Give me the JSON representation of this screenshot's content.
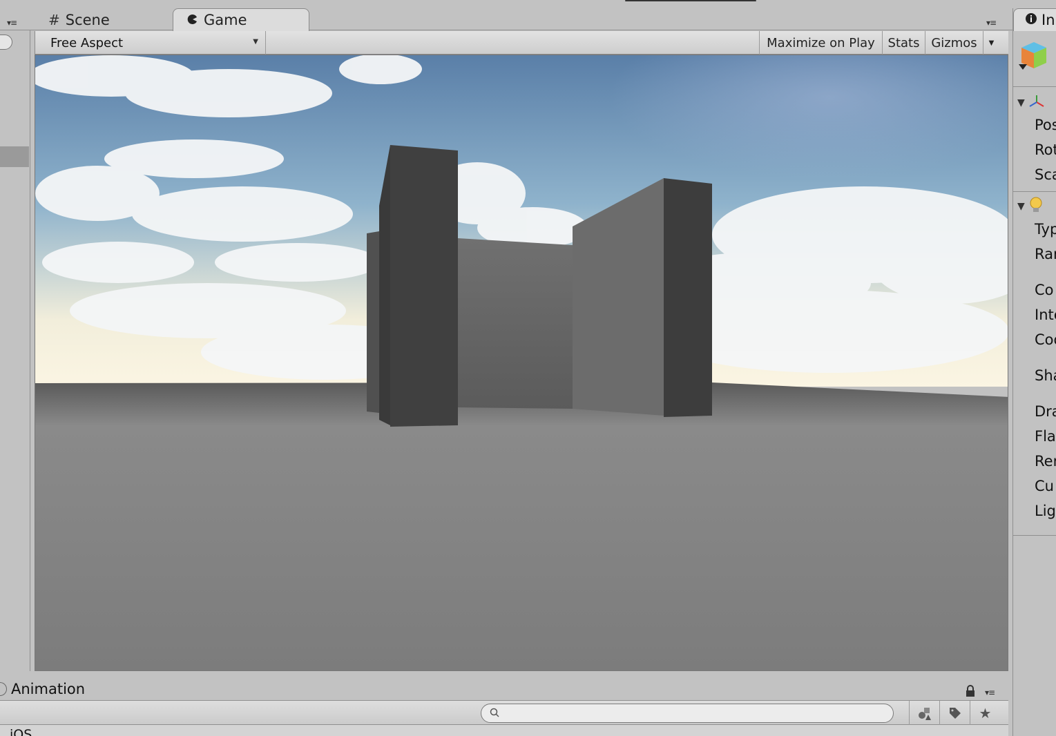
{
  "tabs": {
    "scene": {
      "label": "Scene",
      "icon": "grid-icon"
    },
    "game": {
      "label": "Game",
      "icon": "pacman-icon"
    }
  },
  "game_toolbar": {
    "aspect": "Free Aspect",
    "maximize_on_play": "Maximize on Play",
    "stats": "Stats",
    "gizmos": "Gizmos"
  },
  "inspector": {
    "tab_label": "In",
    "transform": {
      "props": [
        "Pos",
        "Rot",
        "Sca"
      ]
    },
    "light": {
      "props": [
        "Typ",
        "Ran",
        "Co",
        "Inte",
        "Coo",
        "Sha",
        "Dra",
        "Fla",
        "Ren",
        "Cu",
        "Lig"
      ]
    }
  },
  "animation": {
    "label": "Animation"
  },
  "project": {
    "search_placeholder": "",
    "first_item": "iOS"
  },
  "colors": {
    "panel_bg": "#c2c2c2",
    "sky_top": "#5f86b0",
    "ground": "#7e7e7e",
    "wall_dark": "#3f3f3f",
    "wall_mid": "#6a6a6a"
  }
}
